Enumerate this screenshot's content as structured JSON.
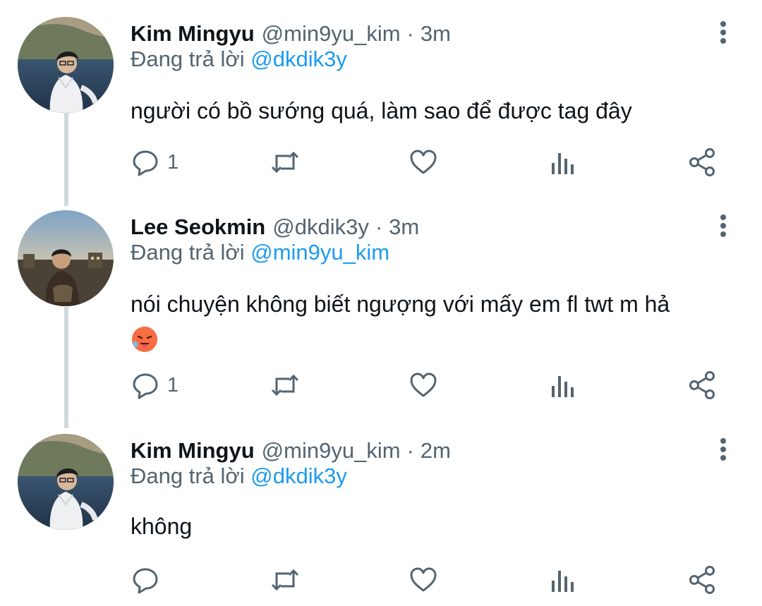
{
  "colors": {
    "text": "#0f1419",
    "secondary": "#536471",
    "link": "#1d9bf0",
    "thread_line": "#cfd9de"
  },
  "tweets": [
    {
      "name": "Kim Mingyu",
      "handle": "@min9yu_kim",
      "separator": "·",
      "time": "3m",
      "reply_prefix": "Đang trả lời",
      "reply_to": "@dkdik3y",
      "text": "người có bồ sướng quá, làm sao để được tag đây",
      "reply_count": "1",
      "avatar_icon": "avatar-photo"
    },
    {
      "name": "Lee Seokmin",
      "handle": "@dkdik3y",
      "separator": "·",
      "time": "3m",
      "reply_prefix": "Đang trả lời",
      "reply_to": "@min9yu_kim",
      "text": "nói chuyện không biết ngượng với mấy em fl twt m hả",
      "emoji": "hot-face-emoji",
      "reply_count": "1",
      "avatar_icon": "avatar-photo"
    },
    {
      "name": "Kim Mingyu",
      "handle": "@min9yu_kim",
      "separator": "·",
      "time": "2m",
      "reply_prefix": "Đang trả lời",
      "reply_to": "@dkdik3y",
      "text": "không",
      "reply_count": "",
      "avatar_icon": "avatar-photo"
    }
  ],
  "icons": [
    "more-vertical-icon",
    "reply-icon",
    "retweet-icon",
    "like-icon",
    "views-icon",
    "share-icon"
  ]
}
